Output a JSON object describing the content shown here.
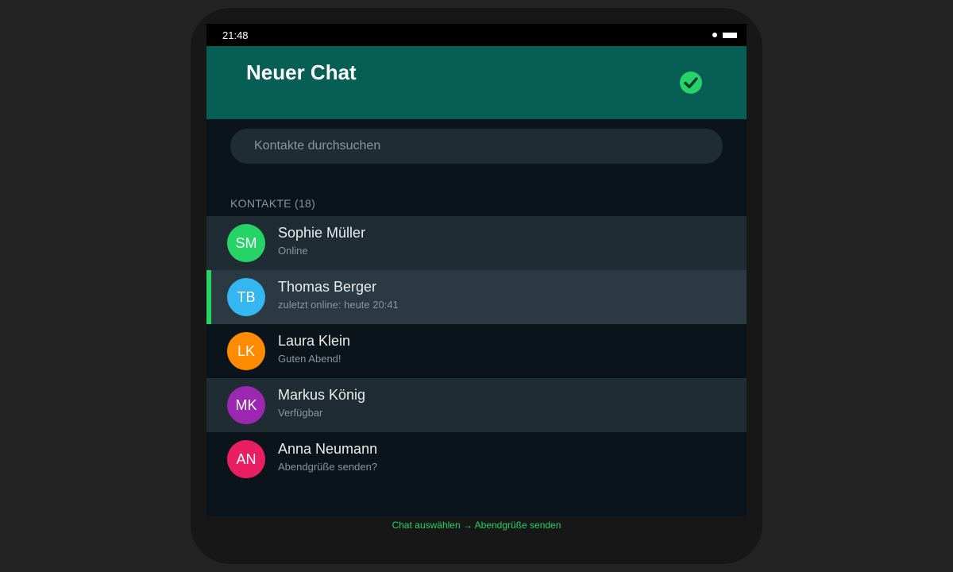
{
  "status_bar": {
    "time": "21:48"
  },
  "header": {
    "title": "Neuer Chat",
    "confirm_icon": "check-circle-icon",
    "accent": "#075e54"
  },
  "search": {
    "placeholder": "Kontakte durchsuchen",
    "value": ""
  },
  "contacts_section": {
    "label": "KONTAKTE (18)"
  },
  "contacts": [
    {
      "initials": "SM",
      "name": "Sophie Müller",
      "status": "Online",
      "color": "#25d366"
    },
    {
      "initials": "TB",
      "name": "Thomas Berger",
      "status": "zuletzt online: heute 20:41",
      "color": "#34b7f1",
      "selected": true
    },
    {
      "initials": "LK",
      "name": "Laura Klein",
      "status": "Guten Abend!",
      "color": "#ff8c00"
    },
    {
      "initials": "MK",
      "name": "Markus König",
      "status": "Verfügbar",
      "color": "#9c27b0"
    },
    {
      "initials": "AN",
      "name": "Anna Neumann",
      "status": "Abendgrüße senden?",
      "color": "#e91e63"
    }
  ],
  "hint": "Chat auswählen → Abendgrüße senden"
}
